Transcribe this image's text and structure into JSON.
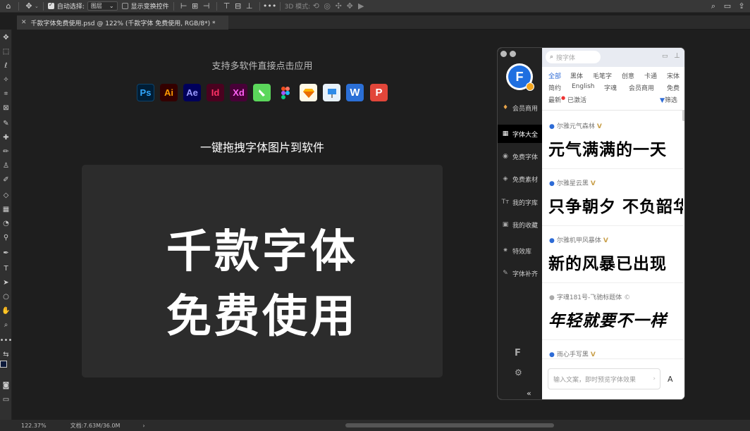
{
  "optbar": {
    "auto_select_label": "自动选择:",
    "layer_select": "图层",
    "show_transform_label": "显示变换控件",
    "mode_3d_label": "3D 模式:"
  },
  "doc_tab": {
    "title": "千款字体免费使用.psd @ 122% (千款字体 免费使用, RGB/8*) *"
  },
  "canvas": {
    "support_text": "支持多软件直接点击应用",
    "drag_text": "一键拖拽字体图片到软件",
    "headline_1": "千款字体",
    "headline_2": "免费使用",
    "apps": [
      {
        "label": "Ps",
        "bg": "#001e36",
        "fg": "#31a8ff"
      },
      {
        "label": "Ai",
        "bg": "#330000",
        "fg": "#ff9a00"
      },
      {
        "label": "Ae",
        "bg": "#00005b",
        "fg": "#9999ff"
      },
      {
        "label": "Id",
        "bg": "#49021f",
        "fg": "#ff3366"
      },
      {
        "label": "Xd",
        "bg": "#470137",
        "fg": "#ff61f6"
      }
    ]
  },
  "status": {
    "zoom": "122.37%",
    "doc_size": "文档:7.63M/36.0M",
    "arrow": "›"
  },
  "plugin": {
    "side": {
      "vip": "会员商用",
      "all_fonts": "字体大全",
      "free_fonts": "免费字体",
      "free_assets": "免费素材",
      "my_library": "我的字库",
      "favorites": "我的收藏",
      "effects": "特效库",
      "font_fix": "字体补齐",
      "collapse": "«"
    },
    "search_placeholder": "搜字体",
    "categories_row1": [
      "全部",
      "黑体",
      "毛笔字",
      "创意",
      "卡通",
      "宋体"
    ],
    "categories_row2": [
      "简约",
      "English",
      "字魂",
      "会员商用",
      "免费"
    ],
    "latest": "最新",
    "activated": "已激活",
    "filter": "筛选",
    "fonts": [
      {
        "name": "尔雅元气森林",
        "sample": "元气满满的一天"
      },
      {
        "name": "尔雅星云黑",
        "sample": "只争朝夕 不负韶华"
      },
      {
        "name": "尔雅机甲风暴体",
        "sample": "新的风暴已出现"
      },
      {
        "name": "字魂181号-飞驰标题体",
        "sample": "年轻就要不一样"
      },
      {
        "name": "雨心手写黑",
        "sample": ""
      }
    ],
    "preview_placeholder": "输入文案，即时预览字体效果",
    "preview_btn": "A"
  },
  "colors": {
    "accent": "#2d6bd6",
    "vip_gold": "#c9a04b",
    "bg_dark": "#1e1e1e"
  }
}
